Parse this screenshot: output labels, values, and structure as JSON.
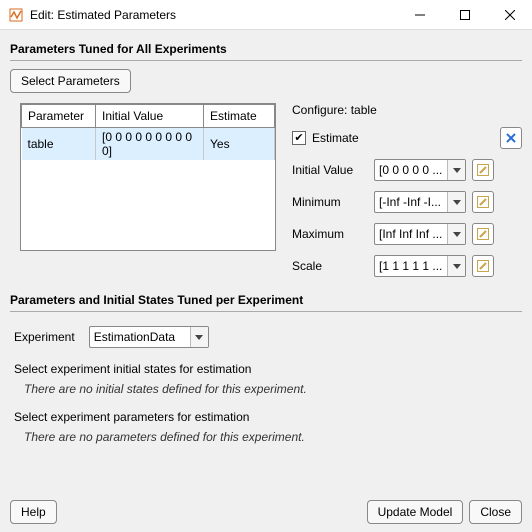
{
  "window": {
    "title": "Edit: Estimated Parameters"
  },
  "section1": {
    "title": "Parameters Tuned for All Experiments",
    "select_button": "Select Parameters"
  },
  "table": {
    "headers": {
      "param": "Parameter",
      "initial": "Initial Value",
      "estimate": "Estimate"
    },
    "rows": [
      {
        "param": "table",
        "initial": "[0 0 0 0 0 0 0 0 0 0]",
        "estimate": "Yes"
      }
    ]
  },
  "config": {
    "header_prefix": "Configure:",
    "header_item": "table",
    "estimate_label": "Estimate",
    "estimate_checked": true,
    "rows": {
      "initial": {
        "label": "Initial Value",
        "value": "[0 0 0 0 0 ..."
      },
      "min": {
        "label": "Minimum",
        "value": "[-Inf -Inf -I..."
      },
      "max": {
        "label": "Maximum",
        "value": "[Inf Inf Inf ..."
      },
      "scale": {
        "label": "Scale",
        "value": "[1 1 1 1 1 ..."
      }
    }
  },
  "section2": {
    "title": "Parameters and Initial States Tuned per Experiment",
    "experiment_label": "Experiment",
    "experiment_value": "EstimationData",
    "sub_states": "Select experiment initial states for estimation",
    "note_states": "There are no initial states defined for this experiment.",
    "sub_params": "Select experiment parameters for estimation",
    "note_params": "There are no parameters defined for this experiment."
  },
  "footer": {
    "help": "Help",
    "update": "Update Model",
    "close": "Close"
  },
  "icons": {
    "reset": "reset-icon",
    "edit": "edit-icon",
    "minimize": "minimize-icon",
    "maximize": "maximize-icon",
    "close": "close-icon",
    "app": "app-icon",
    "chevron": "chevron-down-icon"
  }
}
